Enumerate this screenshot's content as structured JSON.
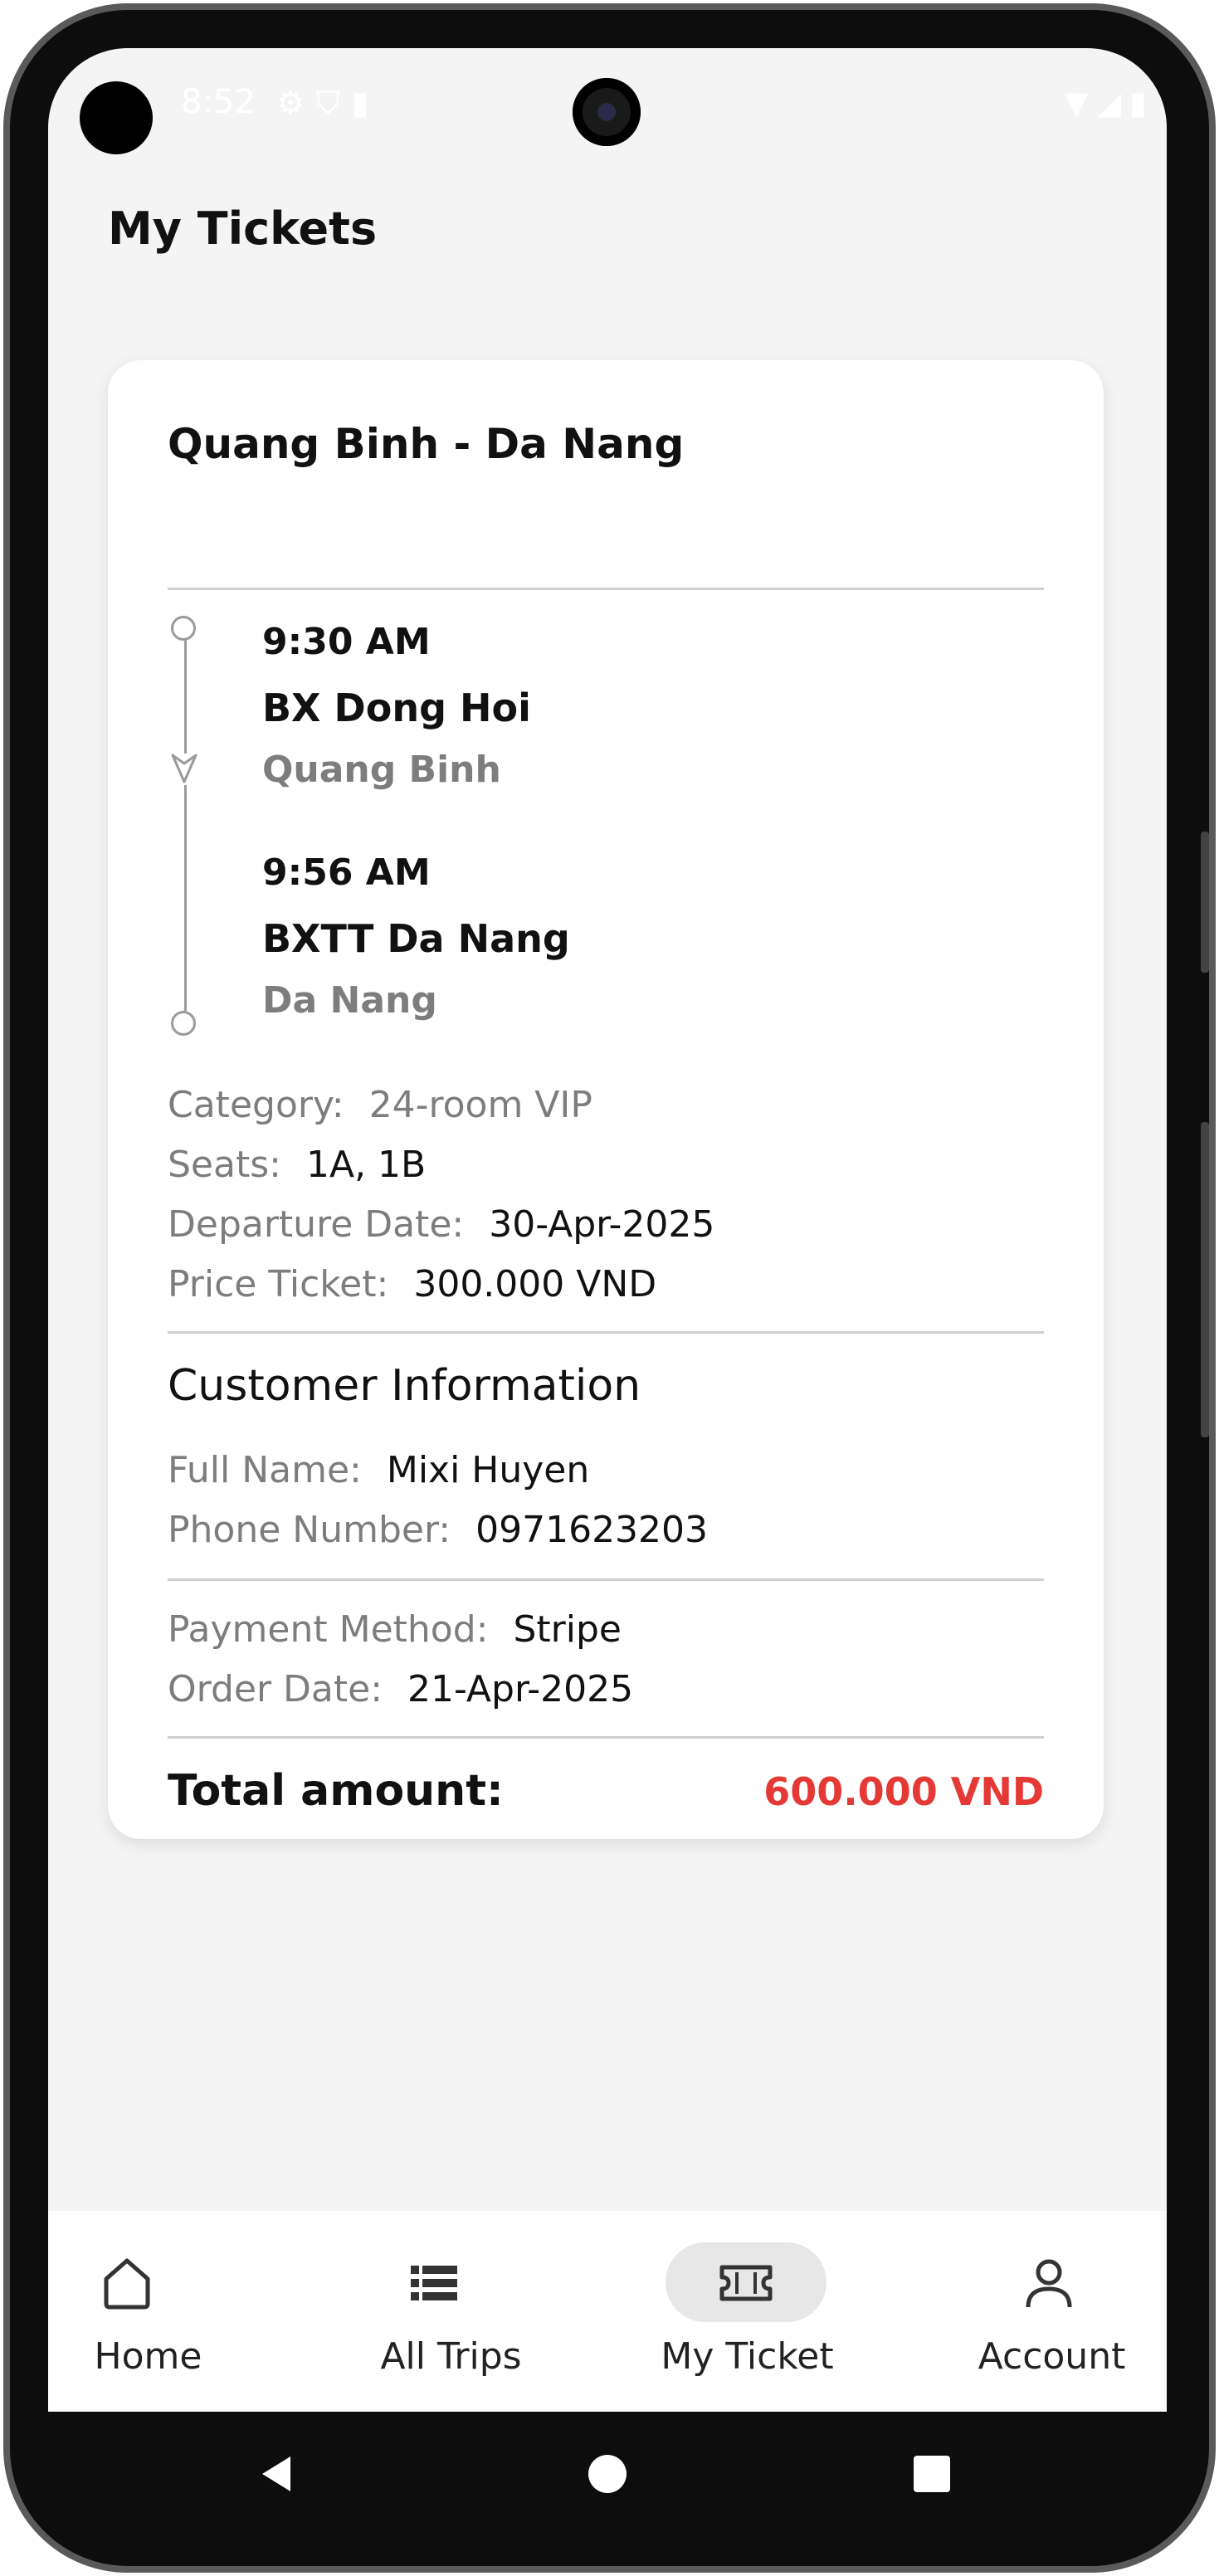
{
  "status_bar": {
    "time": "8:52",
    "left_icons": [
      "gear-icon",
      "shield-icon",
      "sd-card-icon"
    ],
    "right_icons": [
      "wifi-icon",
      "signal-icon",
      "battery-icon"
    ]
  },
  "page": {
    "title": "My Tickets"
  },
  "ticket": {
    "route": "Quang Binh - Da Nang",
    "departure": {
      "time": "9:30 AM",
      "station": "BX Dong Hoi",
      "province": "Quang Binh"
    },
    "arrival": {
      "time": "9:56 AM",
      "station": "BXTT Da Nang",
      "province": "Da Nang"
    },
    "category": {
      "label": "Category:",
      "value": "24-room VIP"
    },
    "seats": {
      "label": "Seats:",
      "value": "1A, 1B"
    },
    "departure_date": {
      "label": "Departure Date:",
      "value": "30-Apr-2025"
    },
    "price": {
      "label": "Price Ticket:",
      "value": "300.000 VND"
    },
    "customer_heading": "Customer Information",
    "full_name": {
      "label": "Full Name:",
      "value": "Mixi Huyen"
    },
    "phone": {
      "label": "Phone Number:",
      "value": "0971623203"
    },
    "payment_method": {
      "label": "Payment Method:",
      "value": "Stripe"
    },
    "order_date": {
      "label": "Order Date:",
      "value": "21-Apr-2025"
    },
    "total": {
      "label": "Total amount:",
      "value": "600.000 VND"
    }
  },
  "bottom_nav": [
    {
      "label": "Home",
      "icon": "home-icon",
      "active": false
    },
    {
      "label": "All Trips",
      "icon": "list-icon",
      "active": false
    },
    {
      "label": "My Ticket",
      "icon": "ticket-icon",
      "active": true
    },
    {
      "label": "Account",
      "icon": "person-icon",
      "active": false
    }
  ],
  "colors": {
    "accent_total": "#e53935",
    "screen_bg": "#f4f4f4",
    "label_gray": "#7d7d7d"
  }
}
